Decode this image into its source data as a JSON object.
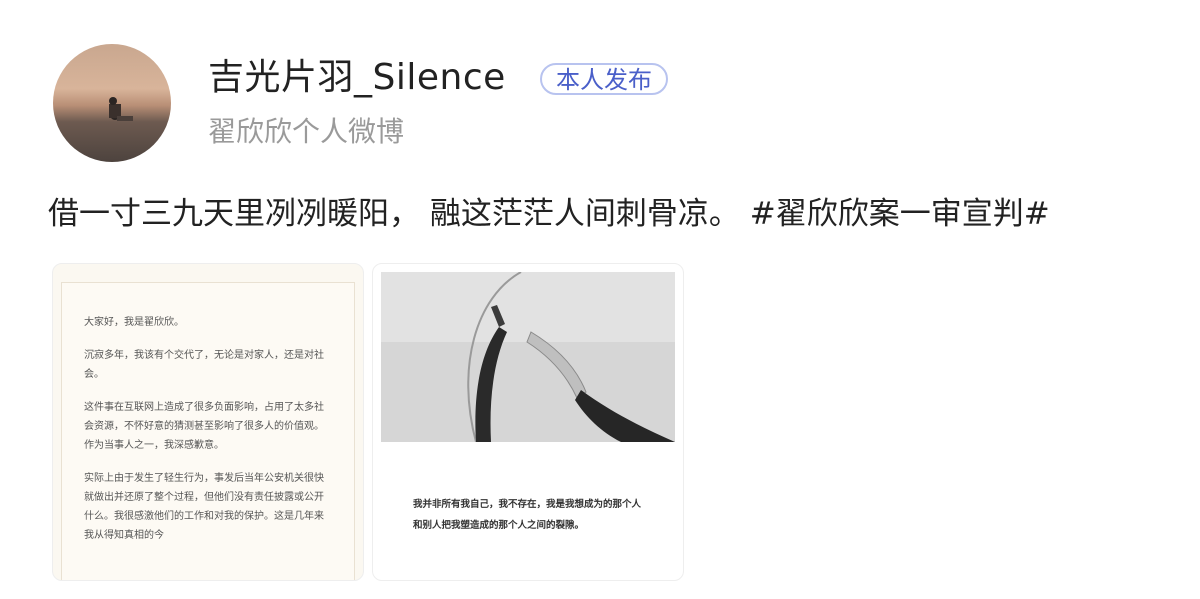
{
  "author": {
    "name": "吉光片羽_Silence",
    "badge": "本人发布",
    "source": "翟欣欣个人微博"
  },
  "post": {
    "text": "借一寸三九天里冽冽暖阳， 融这茫茫人间刺骨凉。",
    "hashtag": "#翟欣欣案一审宣判#"
  },
  "images": {
    "letter_paragraphs": [
      "大家好，我是翟欣欣。",
      "沉寂多年，我该有个交代了，无论是对家人，还是对社会。",
      "这件事在互联网上造成了很多负面影响，占用了太多社会资源，不怀好意的猜测甚至影响了很多人的价值观。作为当事人之一，我深感歉意。",
      "实际上由于发生了轻生行为，事发后当年公安机关很快就做出并还原了整个过程，但他们没有责任披露或公开什么。我很感激他们的工作和对我的保护。这是几年来我从得知真相的今"
    ],
    "photo_caption": "我并非所有我自己，我不存在，我是我想成为的那个人和别人把我塑造成的那个人之间的裂隙。"
  }
}
